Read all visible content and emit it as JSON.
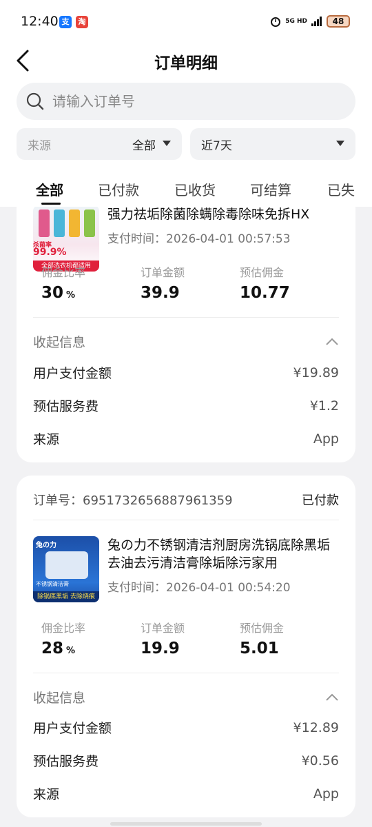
{
  "status_bar": {
    "time": "12:40",
    "network": "5G HD",
    "battery": "48"
  },
  "header": {
    "title": "订单明细",
    "search_placeholder": "请输入订单号"
  },
  "filters": {
    "source_label": "来源",
    "source_value": "全部",
    "time_value": "近7天"
  },
  "tabs": [
    "全部",
    "已付款",
    "已收货",
    "可结算",
    "已失"
  ],
  "orders": [
    {
      "title": "强力祛垢除菌除螨除毒除味免拆HX",
      "pay_time": "支付时间：2026-04-01 00:57:53",
      "thumb_text_1": "杀菌率",
      "thumb_text_2": "99.9%",
      "thumb_text_3": "全部洗衣机都适用",
      "stats": [
        {
          "label": "佣金比率",
          "value": "30",
          "unit": "%"
        },
        {
          "label": "订单金额",
          "value": "39.9"
        },
        {
          "label": "预估佣金",
          "value": "10.77"
        }
      ],
      "collapse_label": "收起信息",
      "details": [
        {
          "k": "用户支付金额",
          "v": "¥19.89"
        },
        {
          "k": "预估服务费",
          "v": "¥1.2"
        },
        {
          "k": "来源",
          "v": "App"
        }
      ]
    },
    {
      "order_no": "订单号：6951732656887961359",
      "status": "已付款",
      "title": "兔の力不锈钢清洁剂厨房洗锅底除黑垢去油去污清洁膏除垢除污家用",
      "pay_time": "支付时间：2026-04-01 00:54:20",
      "thumb_text_1": "兔の力",
      "thumb_text_2": "不锈钢清洁膏",
      "thumb_text_3": "除锅底黑垢 去除烧痕",
      "stats": [
        {
          "label": "佣金比率",
          "value": "28",
          "unit": "%"
        },
        {
          "label": "订单金额",
          "value": "19.9"
        },
        {
          "label": "预估佣金",
          "value": "5.01"
        }
      ],
      "collapse_label": "收起信息",
      "details": [
        {
          "k": "用户支付金额",
          "v": "¥12.89"
        },
        {
          "k": "预估服务费",
          "v": "¥0.56"
        },
        {
          "k": "来源",
          "v": "App"
        }
      ]
    }
  ]
}
